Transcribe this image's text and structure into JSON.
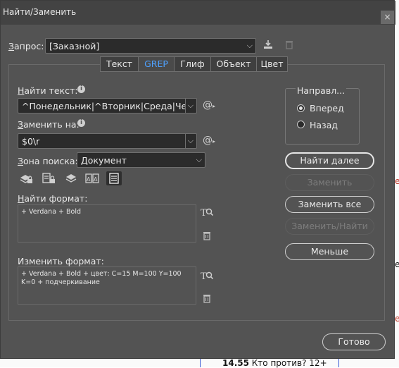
{
  "window": {
    "title": "Найти/Заменить",
    "close": "×"
  },
  "query": {
    "label": "Запрос:",
    "value": "[Заказной]"
  },
  "tabs": [
    {
      "label": "Текст",
      "active": false
    },
    {
      "label": "GREP",
      "active": true
    },
    {
      "label": "Глиф",
      "active": false
    },
    {
      "label": "Объект",
      "active": false
    },
    {
      "label": "Цвет",
      "active": false
    }
  ],
  "find": {
    "label": "Найти текст:",
    "value": "^Понедельник|^Вторник|Среда|Четверг"
  },
  "replace": {
    "label": "Заменить на:",
    "value": "$0\\r"
  },
  "search_scope": {
    "label": "Зона поиска:",
    "value": "Документ"
  },
  "direction": {
    "title": "Направл...",
    "forward": "Вперед",
    "backward": "Назад",
    "selected": "forward"
  },
  "buttons": {
    "find_next": "Найти далее",
    "replace": "Заменить",
    "replace_all": "Заменить все",
    "replace_find": "Заменить/Найти",
    "less": "Меньше",
    "done": "Готово"
  },
  "find_format": {
    "label": "Найти формат:",
    "text": "+ Verdana + Bold"
  },
  "change_format": {
    "label": "Изменить формат:",
    "line1": " + Verdana + Bold + цвет: C=15 M=100 Y=100",
    "line2": "K=0 + подчеркивание"
  },
  "background": {
    "bold": "14.55",
    "rest": " Кто против? 12+"
  },
  "colors": {
    "dialog": "#535353",
    "titlebar": "#434343",
    "accent": "#4ea1ff"
  }
}
